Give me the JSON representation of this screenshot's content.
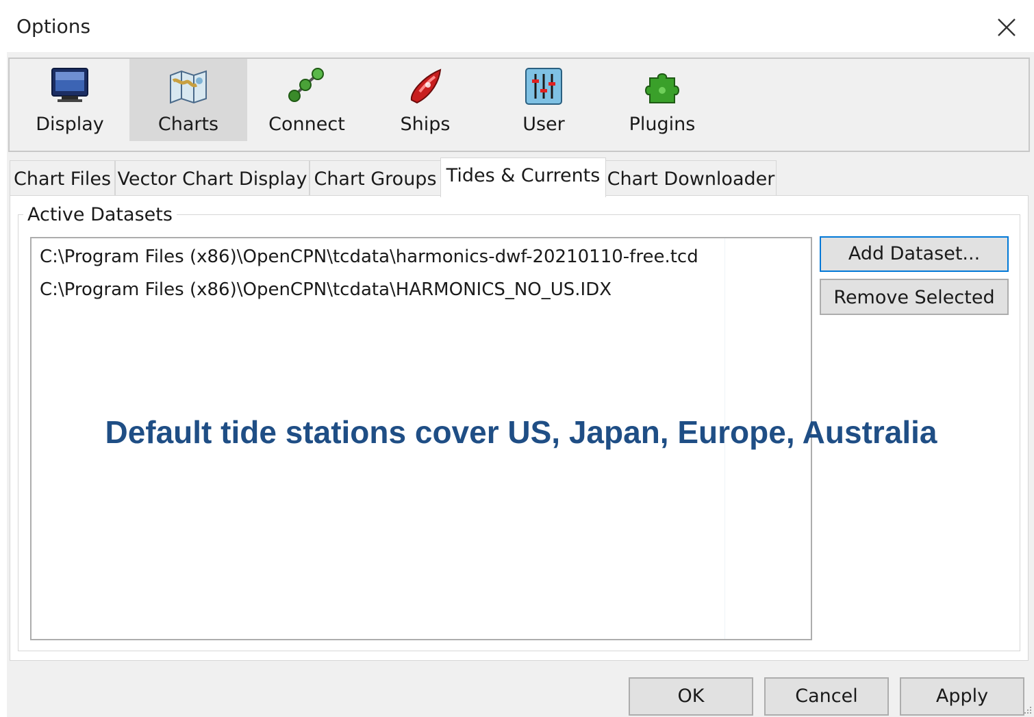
{
  "window": {
    "title": "Options"
  },
  "toolbar": {
    "items": [
      {
        "label": "Display",
        "icon": "monitor-icon"
      },
      {
        "label": "Charts",
        "icon": "chart-map-icon",
        "selected": true
      },
      {
        "label": "Connect",
        "icon": "connect-nodes-icon"
      },
      {
        "label": "Ships",
        "icon": "ship-icon"
      },
      {
        "label": "User",
        "icon": "user-sliders-icon"
      },
      {
        "label": "Plugins",
        "icon": "puzzle-piece-icon"
      }
    ]
  },
  "tabs": [
    {
      "label": "Chart Files"
    },
    {
      "label": "Vector Chart Display"
    },
    {
      "label": "Chart Groups"
    },
    {
      "label": "Tides & Currents",
      "active": true
    },
    {
      "label": "Chart Downloader"
    }
  ],
  "active_datasets": {
    "group_label": "Active Datasets",
    "items": [
      "C:\\Program Files (x86)\\OpenCPN\\tcdata\\harmonics-dwf-20210110-free.tcd",
      "C:\\Program Files (x86)\\OpenCPN\\tcdata\\HARMONICS_NO_US.IDX"
    ],
    "add_label": "Add Dataset...",
    "remove_label": "Remove Selected"
  },
  "overlay_caption": "Default tide stations cover US, Japan, Europe, Australia",
  "footer": {
    "ok_label": "OK",
    "cancel_label": "Cancel",
    "apply_label": "Apply"
  },
  "colors": {
    "focus_border": "#0078d7",
    "caption_text": "#1f4e85",
    "selected_toolbar_bg": "#d9d9d9"
  }
}
